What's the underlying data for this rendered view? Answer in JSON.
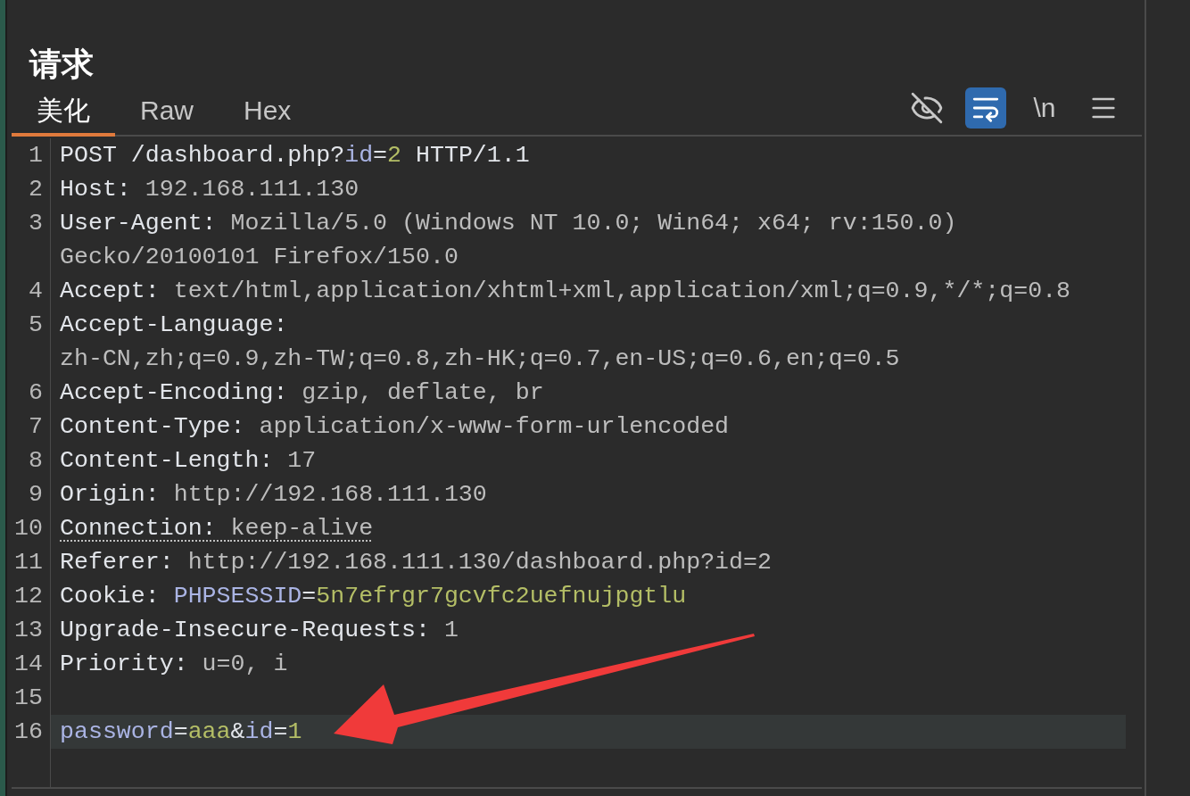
{
  "panel": {
    "title": "请求"
  },
  "tabs": [
    {
      "label": "美化",
      "selected": true
    },
    {
      "label": "Raw",
      "selected": false
    },
    {
      "label": "Hex",
      "selected": false
    }
  ],
  "toolbar": [
    {
      "kind": "eye-off",
      "selected": false
    },
    {
      "kind": "wrap",
      "selected": true
    },
    {
      "kind": "text",
      "label": "\\n",
      "selected": false
    },
    {
      "kind": "menu",
      "selected": false
    }
  ],
  "lines": [
    {
      "number": "1",
      "underlined": false,
      "selected": false,
      "rows": [
        [
          {
            "kind": "name",
            "text": "POST /dashboard.php?"
          },
          {
            "kind": "param",
            "text": "id"
          },
          {
            "kind": "name",
            "text": "="
          },
          {
            "kind": "param-value",
            "text": "2"
          },
          {
            "kind": "name",
            "text": " HTTP/1.1"
          }
        ]
      ]
    },
    {
      "number": "2",
      "underlined": false,
      "selected": false,
      "rows": [
        [
          {
            "kind": "name",
            "text": "Host: "
          },
          {
            "kind": "value",
            "text": "192.168.111.130"
          }
        ]
      ]
    },
    {
      "number": "3",
      "underlined": false,
      "selected": false,
      "rows": [
        [
          {
            "kind": "name",
            "text": "User-Agent: "
          },
          {
            "kind": "value",
            "text": "Mozilla/5.0 (Windows NT 10.0; Win64; x64; rv:150.0)"
          }
        ],
        [
          {
            "kind": "value",
            "text": "Gecko/20100101 Firefox/150.0"
          }
        ]
      ]
    },
    {
      "number": "4",
      "underlined": false,
      "selected": false,
      "rows": [
        [
          {
            "kind": "name",
            "text": "Accept: "
          },
          {
            "kind": "value",
            "text": "text/html,application/xhtml+xml,application/xml;q=0.9,*/*;q=0.8"
          }
        ]
      ]
    },
    {
      "number": "5",
      "underlined": false,
      "selected": false,
      "rows": [
        [
          {
            "kind": "name",
            "text": "Accept-Language:"
          }
        ],
        [
          {
            "kind": "value",
            "text": "zh-CN,zh;q=0.9,zh-TW;q=0.8,zh-HK;q=0.7,en-US;q=0.6,en;q=0.5"
          }
        ]
      ]
    },
    {
      "number": "6",
      "underlined": false,
      "selected": false,
      "rows": [
        [
          {
            "kind": "name",
            "text": "Accept-Encoding: "
          },
          {
            "kind": "value",
            "text": "gzip, deflate, br"
          }
        ]
      ]
    },
    {
      "number": "7",
      "underlined": false,
      "selected": false,
      "rows": [
        [
          {
            "kind": "name",
            "text": "Content-Type: "
          },
          {
            "kind": "value",
            "text": "application/x-www-form-urlencoded"
          }
        ]
      ]
    },
    {
      "number": "8",
      "underlined": false,
      "selected": false,
      "rows": [
        [
          {
            "kind": "name",
            "text": "Content-Length: "
          },
          {
            "kind": "value",
            "text": "17"
          }
        ]
      ]
    },
    {
      "number": "9",
      "underlined": false,
      "selected": false,
      "rows": [
        [
          {
            "kind": "name",
            "text": "Origin: "
          },
          {
            "kind": "value",
            "text": "http://192.168.111.130"
          }
        ]
      ]
    },
    {
      "number": "10",
      "underlined": true,
      "selected": false,
      "rows": [
        [
          {
            "kind": "name",
            "text": "Connection: "
          },
          {
            "kind": "value",
            "text": "keep-alive"
          }
        ]
      ]
    },
    {
      "number": "11",
      "underlined": false,
      "selected": false,
      "rows": [
        [
          {
            "kind": "name",
            "text": "Referer: "
          },
          {
            "kind": "value",
            "text": "http://192.168.111.130/dashboard.php?id=2"
          }
        ]
      ]
    },
    {
      "number": "12",
      "underlined": false,
      "selected": false,
      "rows": [
        [
          {
            "kind": "name",
            "text": "Cookie: "
          },
          {
            "kind": "param",
            "text": "PHPSESSID"
          },
          {
            "kind": "name",
            "text": "="
          },
          {
            "kind": "param-value",
            "text": "5n7efrgr7gcvfc2uefnujpgtlu"
          }
        ]
      ]
    },
    {
      "number": "13",
      "underlined": false,
      "selected": false,
      "rows": [
        [
          {
            "kind": "name",
            "text": "Upgrade-Insecure-Requests: "
          },
          {
            "kind": "value",
            "text": "1"
          }
        ]
      ]
    },
    {
      "number": "14",
      "underlined": false,
      "selected": false,
      "rows": [
        [
          {
            "kind": "name",
            "text": "Priority: "
          },
          {
            "kind": "value",
            "text": "u=0, i"
          }
        ]
      ]
    },
    {
      "number": "15",
      "selected": false
    },
    {
      "number": "16",
      "underlined": false,
      "selected": true,
      "rows": [
        [
          {
            "kind": "param",
            "text": "password"
          },
          {
            "kind": "name",
            "text": "="
          },
          {
            "kind": "param-value",
            "text": "aaa"
          },
          {
            "kind": "name",
            "text": "&"
          },
          {
            "kind": "param",
            "text": "id"
          },
          {
            "kind": "name",
            "text": "="
          },
          {
            "kind": "param-value",
            "text": "1"
          }
        ]
      ]
    }
  ]
}
